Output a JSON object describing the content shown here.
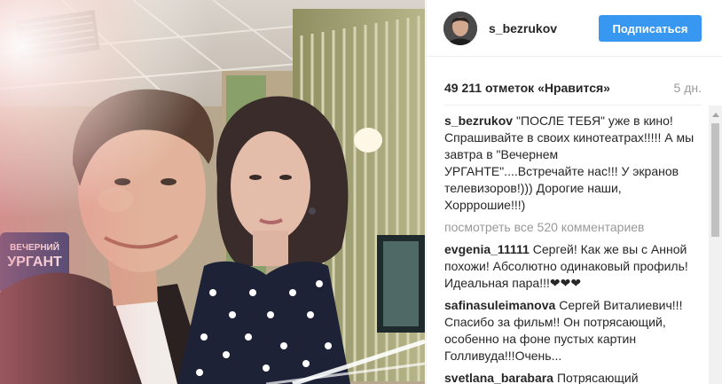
{
  "post": {
    "username": "s_bezrukov",
    "follow_label": "Подписаться",
    "likes": "49 211 отметок «Нравится»",
    "time_ago": "5 дн.",
    "view_all_comments": "посмотреть все 520 комментариев"
  },
  "caption": {
    "author": "s_bezrukov",
    "text": "\"ПОСЛЕ ТЕБЯ\" уже в кино! Спрашивайте в своих кинотеатрах!!!!! А мы завтра в \"Вечернем УРГАНТЕ\"....Встречайте нас!!! У экранов телевизоров!))) Дорогие наши, Хорррошие!!!)"
  },
  "comments": [
    {
      "author": "evgenia_11111",
      "text": "Сергей! Как же вы с Анной похожи! Абсолютно одинаковый профиль! Идеальная пара!!!❤❤❤"
    },
    {
      "author": "safinasuleimanova",
      "text": "Сергей Виталиевич!!! Спасибо за фильм!! Он потрясающий, особенно на фоне пустых картин Голливуда!!!Очень..."
    },
    {
      "author": "svetlana_barabara",
      "text": "Потрясающий"
    }
  ],
  "photo": {
    "sign_text": "ВЕЧЕРНИЙ УРГАНТ"
  },
  "colors": {
    "follow_button": "#3897f0",
    "muted_text": "#999999",
    "primary_text": "#262626"
  }
}
